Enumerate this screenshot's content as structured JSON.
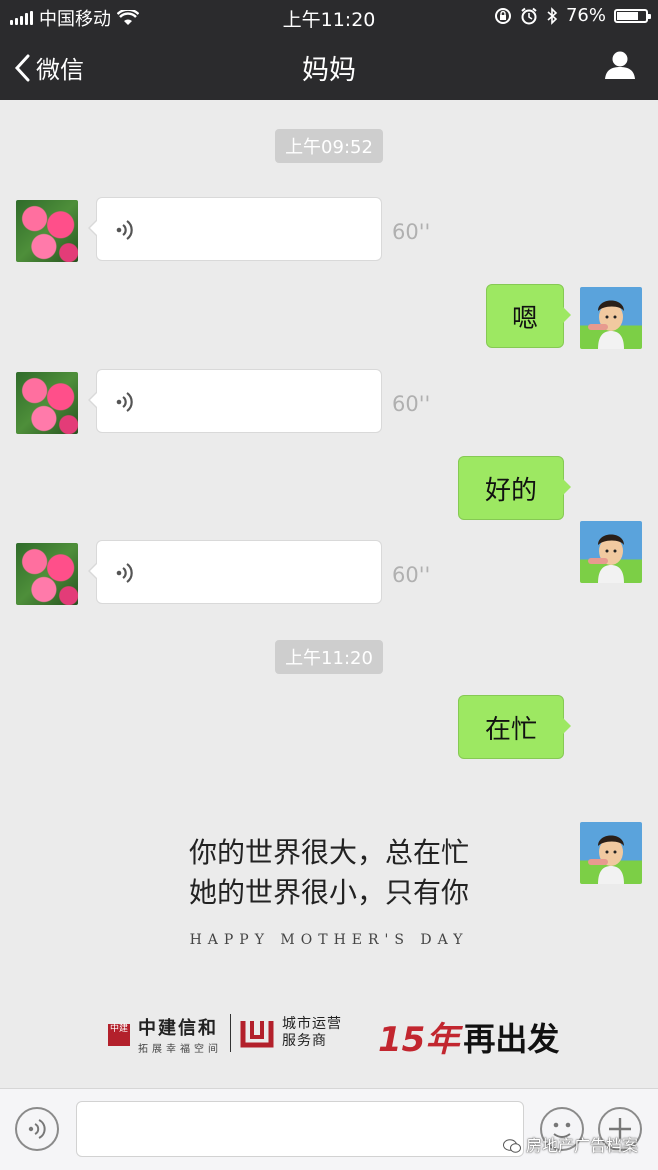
{
  "status": {
    "carrier": "中国移动",
    "time": "上午11:20",
    "battery": "76%",
    "battery_level": 0.76
  },
  "nav": {
    "back_label": "微信",
    "title": "妈妈"
  },
  "chat": {
    "timestamps": [
      "上午09:52",
      "上午11:20"
    ],
    "voice_durations": [
      "60''",
      "60''",
      "60''"
    ],
    "replies": [
      "嗯",
      "好的",
      "在忙"
    ]
  },
  "poster": {
    "line1": "你的世界很大，总在忙",
    "line2": "她的世界很小，只有你",
    "tagline": "HAPPY MOTHER'S DAY",
    "brand1": "中建信和",
    "brand1_sub": "拓展幸福空间",
    "brand2_line1": "城市运营",
    "brand2_line2": "服务商",
    "campaign_num": "15年",
    "campaign_text": "再出发"
  },
  "watermark": "房地产广告档案",
  "colors": {
    "nav_bg": "#2b2b2d",
    "chat_bg": "#ebebeb",
    "reply_bubble": "#9de862",
    "brand_red": "#b3202b"
  },
  "icons": [
    "signal-icon",
    "wifi-icon",
    "lock-rotation-icon",
    "alarm-icon",
    "bluetooth-icon",
    "battery-icon",
    "back-chevron-icon",
    "contact-icon",
    "voice-wave-icon",
    "emoji-icon",
    "plus-icon"
  ]
}
